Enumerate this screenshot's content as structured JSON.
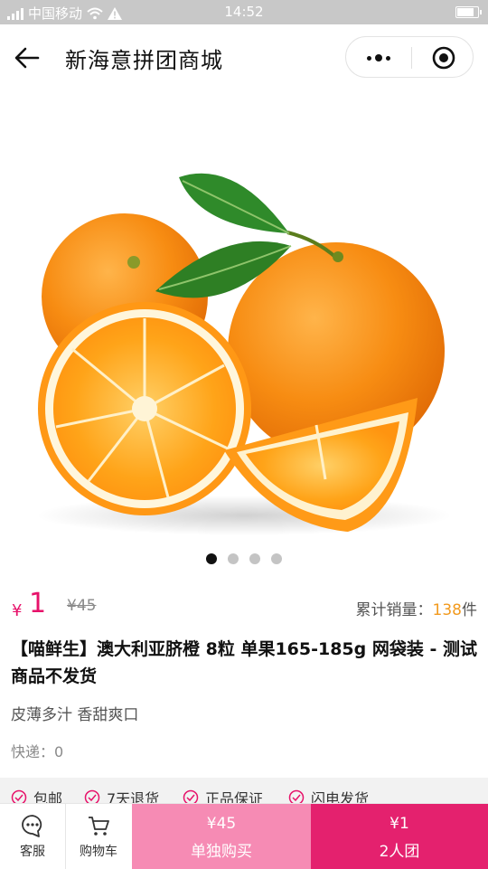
{
  "status_bar": {
    "carrier": "中国移动",
    "time": "14:52"
  },
  "nav": {
    "title": "新海意拼团商城",
    "icons": [
      "back-arrow-icon",
      "more-dots-icon",
      "close-target-icon"
    ]
  },
  "gallery": {
    "image": "oranges",
    "page_count": 4,
    "active_index": 0
  },
  "product": {
    "currency": "¥",
    "price": "1",
    "original_price": "¥45",
    "sales_label": "累计销量：",
    "sales_count": "138",
    "sales_unit": "件",
    "title": "【喵鲜生】澳大利亚脐橙 8粒 单果165-185g 网袋装 - 测试商品不发货",
    "subtitle": "皮薄多汁 香甜爽口",
    "express": "快递：0"
  },
  "guarantees": [
    "包邮",
    "7天退货",
    "正品保证",
    "闪电发货"
  ],
  "bottom_bar": {
    "service_label": "客服",
    "cart_label": "购物车",
    "solo_price": "¥45",
    "solo_label": "单独购买",
    "group_price": "¥1",
    "group_label": "2人团"
  },
  "colors": {
    "accent": "#e7126a",
    "solo_button": "#f68bb4",
    "group_button": "#e4216e",
    "sales_number": "#f29a1e",
    "status_bar": "#c8c8c8"
  }
}
